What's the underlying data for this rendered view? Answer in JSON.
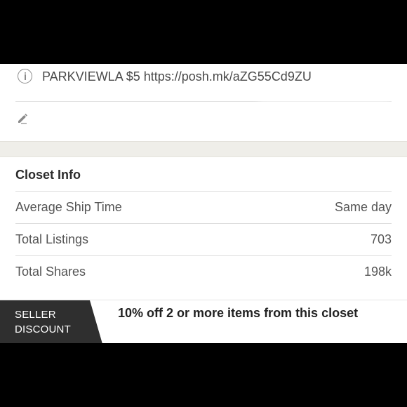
{
  "info": {
    "icon": "info-circle-icon",
    "text": "PARKVIEWLA $5 https://posh.mk/aZG55Cd9ZU"
  },
  "edit": {
    "icon": "pencil-icon",
    "placeholder": ""
  },
  "closet_info": {
    "title": "Closet Info",
    "rows": [
      {
        "label": "Average Ship Time",
        "value": "Same day"
      },
      {
        "label": "Total Listings",
        "value": "703"
      },
      {
        "label": "Total Shares",
        "value": "198k"
      }
    ]
  },
  "seller_discount": {
    "badge_line1": "SELLER",
    "badge_line2": "DISCOUNT",
    "text": "10% off 2 or more items from this closet",
    "badge_color": "#2f2f2f"
  }
}
